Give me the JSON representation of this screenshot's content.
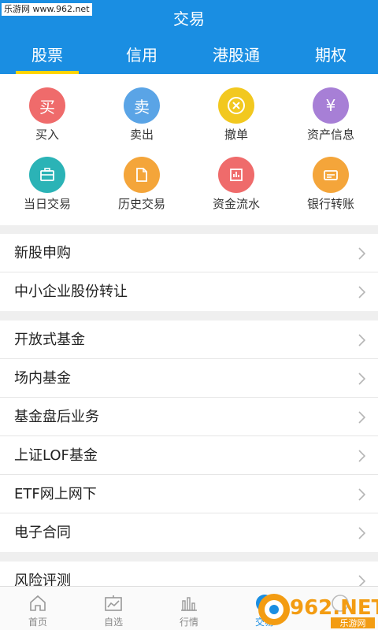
{
  "watermark": "乐游网 www.962.net",
  "title": "交易",
  "tabs": [
    {
      "label": "股票"
    },
    {
      "label": "信用"
    },
    {
      "label": "港股通"
    },
    {
      "label": "期权"
    }
  ],
  "actions": [
    {
      "label": "买入",
      "glyph": "买",
      "color": "#ef6b6b",
      "icon": "buy-icon"
    },
    {
      "label": "卖出",
      "glyph": "卖",
      "color": "#5aa4e6",
      "icon": "sell-icon"
    },
    {
      "label": "撤单",
      "glyph": "⊗",
      "color": "#f2c81f",
      "icon": "cancel-order-icon"
    },
    {
      "label": "资产信息",
      "glyph": "¥",
      "color": "#a77fd6",
      "icon": "assets-icon"
    },
    {
      "label": "当日交易",
      "glyph": "",
      "color": "#2bb3b6",
      "icon": "briefcase-icon"
    },
    {
      "label": "历史交易",
      "glyph": "",
      "color": "#f4a53a",
      "icon": "document-icon"
    },
    {
      "label": "资金流水",
      "glyph": "",
      "color": "#ef6b6b",
      "icon": "bar-chart-icon"
    },
    {
      "label": "银行转账",
      "glyph": "",
      "color": "#f4a53a",
      "icon": "card-icon"
    }
  ],
  "menu_groups": [
    [
      "新股申购",
      "中小企业股份转让"
    ],
    [
      "开放式基金",
      "场内基金",
      "基金盘后业务",
      "上证LOF基金",
      "ETF网上网下",
      "电子合同"
    ],
    [
      "风险评测"
    ]
  ],
  "bottom_nav": [
    {
      "label": "首页",
      "icon": "home-icon"
    },
    {
      "label": "自选",
      "icon": "watchlist-icon"
    },
    {
      "label": "行情",
      "icon": "market-icon"
    },
    {
      "label": "交易",
      "icon": "trade-icon"
    },
    {
      "label": "",
      "icon": "more-icon"
    }
  ],
  "logo": {
    "text": "962.NET",
    "subtitle": "乐游网"
  },
  "colors": {
    "primary": "#1a8ee2",
    "tab_indicator": "#ffd400",
    "logo_orange": "#f39c12"
  }
}
